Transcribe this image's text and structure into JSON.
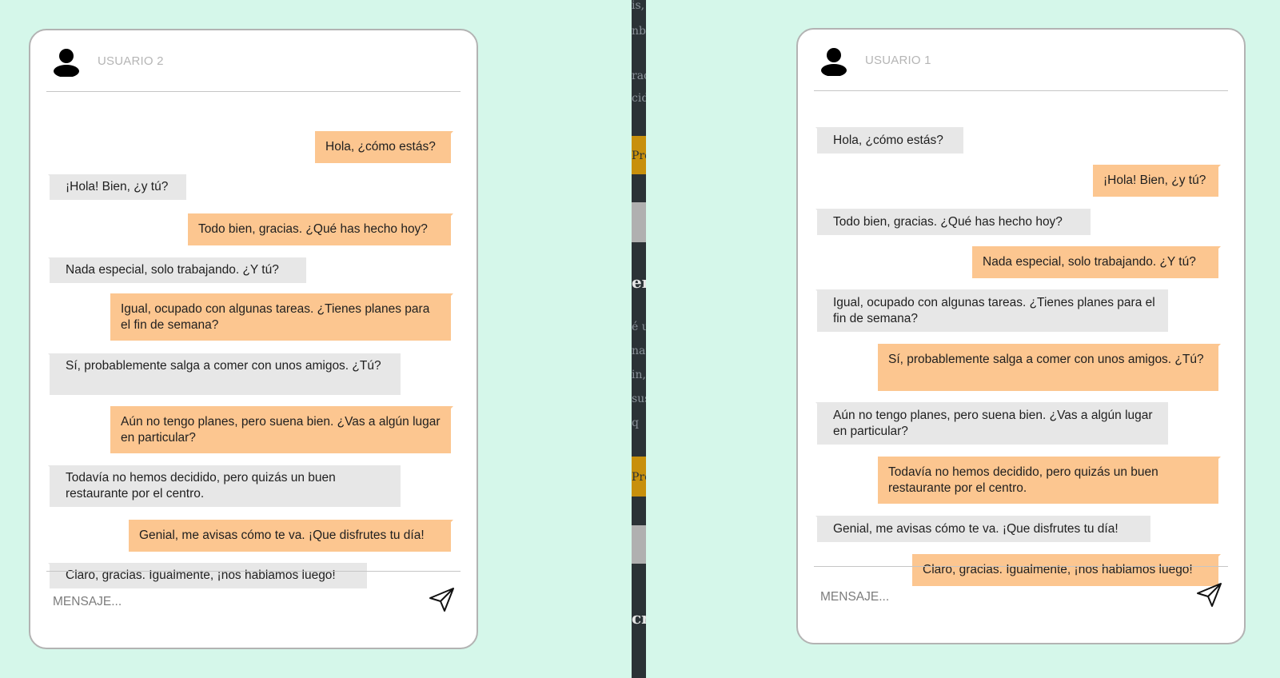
{
  "colors": {
    "background": "#d5f7ea",
    "bubble_sent": "#fcc690",
    "bubble_received": "#e7e7e7",
    "divider": "#2b3236",
    "divider_accent": "#c8900c"
  },
  "divider": {
    "fragments": [
      "is, d",
      "nbi",
      "rac",
      "cid",
      "Pro",
      "er",
      "é u",
      "nar",
      "in,",
      "sus",
      "q",
      "Pro",
      "cr"
    ]
  },
  "chats": [
    {
      "user": "USUARIO 2",
      "avatar_icon": "user-icon",
      "send_icon": "paper-plane-icon",
      "input_placeholder": "MENSAJE...",
      "messages": [
        {
          "dir": "out",
          "text": "Hola, ¿cómo estás?"
        },
        {
          "dir": "in",
          "text": "¡Hola! Bien, ¿y tú?"
        },
        {
          "dir": "out",
          "text": "Todo bien, gracias. ¿Qué has hecho hoy?"
        },
        {
          "dir": "in",
          "text": "Nada especial, solo trabajando. ¿Y tú?"
        },
        {
          "dir": "out",
          "text": "Igual, ocupado con algunas tareas. ¿Tienes planes para el fin de semana?"
        },
        {
          "dir": "in",
          "text": "Sí, probablemente salga a comer con unos amigos. ¿Tú?"
        },
        {
          "dir": "out",
          "text": "Aún no tengo planes, pero suena bien. ¿Vas a algún lugar en particular?"
        },
        {
          "dir": "in",
          "text": "Todavía no hemos decidido, pero quizás un buen restaurante por el centro."
        },
        {
          "dir": "out",
          "text": "Genial, me avisas cómo te va. ¡Que disfrutes tu día!"
        },
        {
          "dir": "in",
          "text": "Claro, gracias. Igualmente, ¡nos hablamos luego!"
        }
      ]
    },
    {
      "user": "USUARIO 1",
      "avatar_icon": "user-icon",
      "send_icon": "paper-plane-icon",
      "input_placeholder": "MENSAJE...",
      "messages": [
        {
          "dir": "in",
          "text": "Hola, ¿cómo estás?"
        },
        {
          "dir": "out",
          "text": "¡Hola! Bien, ¿y tú?"
        },
        {
          "dir": "in",
          "text": "Todo bien, gracias. ¿Qué has hecho hoy?"
        },
        {
          "dir": "out",
          "text": "Nada especial, solo trabajando. ¿Y tú?"
        },
        {
          "dir": "in",
          "text": "Igual, ocupado con algunas tareas. ¿Tienes planes para el fin de semana?"
        },
        {
          "dir": "out",
          "text": "Sí, probablemente salga a comer con unos amigos. ¿Tú?"
        },
        {
          "dir": "in",
          "text": "Aún no tengo planes, pero suena bien. ¿Vas a algún lugar en particular?"
        },
        {
          "dir": "out",
          "text": "Todavía no hemos decidido, pero quizás un buen restaurante por el centro."
        },
        {
          "dir": "in",
          "text": "Genial, me avisas cómo te va. ¡Que disfrutes tu día!"
        },
        {
          "dir": "out",
          "text": "Claro, gracias. Igualmente, ¡nos hablamos luego!"
        }
      ]
    }
  ]
}
